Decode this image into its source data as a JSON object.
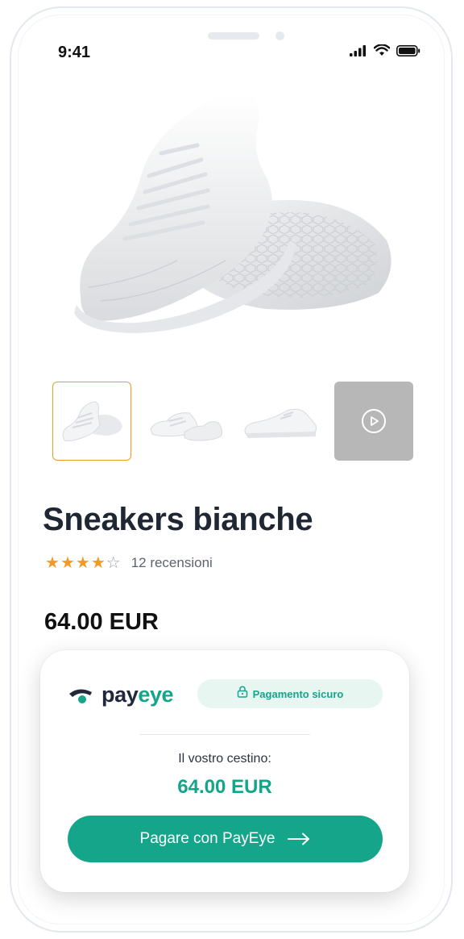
{
  "status_bar": {
    "time": "9:41"
  },
  "product": {
    "title": "Sneakers bianche",
    "rating": 4,
    "rating_max": 5,
    "reviews": "12 recensioni",
    "price": "64.00 EUR"
  },
  "thumbnails": [
    {
      "kind": "image",
      "selected": true
    },
    {
      "kind": "image",
      "selected": false
    },
    {
      "kind": "image",
      "selected": false
    },
    {
      "kind": "video",
      "selected": false
    }
  ],
  "payment": {
    "brand_pay": "pay",
    "brand_eye": "eye",
    "secure_label": "Pagamento sicuro",
    "basket_label": "Il vostro cestino:",
    "basket_amount": "64.00 EUR",
    "button_label": "Pagare con PayEye"
  },
  "colors": {
    "accent_orange": "#f39a26",
    "brand_green": "#14a58b",
    "title_dark": "#1f2733"
  },
  "icons": [
    "signal-icon",
    "wifi-icon",
    "battery-icon",
    "star-icon",
    "play-icon",
    "lock-icon",
    "arrow-right-icon"
  ]
}
